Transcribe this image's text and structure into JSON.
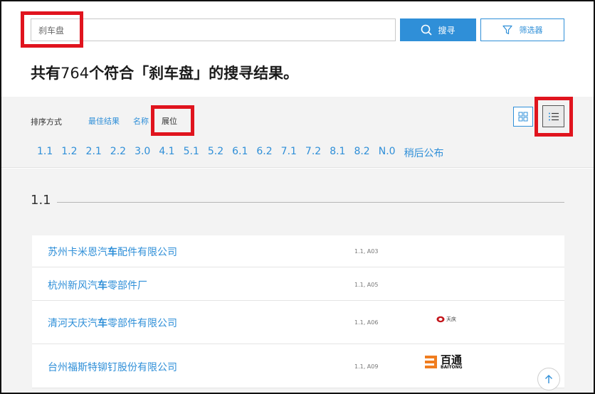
{
  "search": {
    "placeholder": "",
    "value": "刹车盘",
    "button_label": "搜寻",
    "filter_label": "筛选器"
  },
  "results": {
    "prefix": "共有",
    "count": "764",
    "suffix": "个符合「刹车盘」的搜寻结果。"
  },
  "sort": {
    "label": "排序方式",
    "options": [
      "最佳结果",
      "名称",
      "展位"
    ],
    "active": "展位"
  },
  "categories": [
    "1.1",
    "1.2",
    "2.1",
    "2.2",
    "3.0",
    "4.1",
    "5.1",
    "5.2",
    "6.1",
    "6.2",
    "7.1",
    "7.2",
    "8.1",
    "8.2",
    "N.0",
    "稍后公布"
  ],
  "section": {
    "title": "1.1"
  },
  "exhibitors": [
    {
      "name_pre": "苏州卡米恩汽",
      "name_bold": "车",
      "name_post": "配件有限公司",
      "location": "1.1, A03",
      "logo": ""
    },
    {
      "name_pre": "杭州新风汽",
      "name_bold": "车",
      "name_post": "零部件厂",
      "location": "1.1, A05",
      "logo": ""
    },
    {
      "name_pre": "清河天庆汽",
      "name_bold": "车",
      "name_post": "零部件有限公司",
      "location": "1.1, A06",
      "logo": "天庆"
    },
    {
      "name_pre": "台州福斯特铆钉股份有限公司",
      "name_bold": "",
      "name_post": "",
      "location": "1.1, A09",
      "logo": "百通",
      "logo_sub": "BAITONG"
    }
  ],
  "colors": {
    "accent": "#2f8fd8",
    "highlight": "#e0141e",
    "band": "#f3f3f3"
  }
}
